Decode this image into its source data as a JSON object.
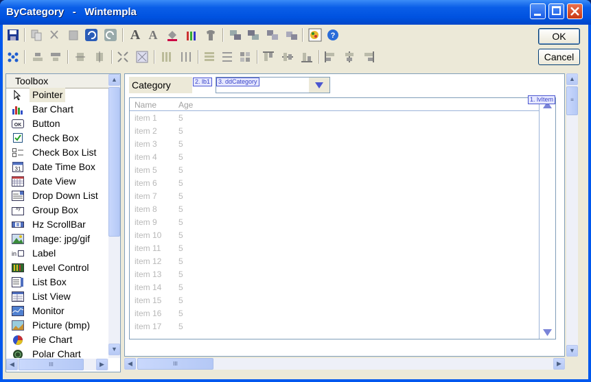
{
  "window": {
    "title": "ByCategory   -   Wintempla"
  },
  "buttons": {
    "ok": "OK",
    "cancel": "Cancel"
  },
  "toolbox": {
    "header": "Toolbox",
    "items": [
      {
        "label": "Pointer",
        "icon": "pointer-icon"
      },
      {
        "label": "Bar Chart",
        "icon": "bar-chart-icon"
      },
      {
        "label": "Button",
        "icon": "button-icon"
      },
      {
        "label": "Check Box",
        "icon": "check-box-icon"
      },
      {
        "label": "Check Box List",
        "icon": "check-box-list-icon"
      },
      {
        "label": "Date Time Box",
        "icon": "date-time-box-icon"
      },
      {
        "label": "Date View",
        "icon": "date-view-icon"
      },
      {
        "label": "Drop Down List",
        "icon": "drop-down-list-icon"
      },
      {
        "label": "Group Box",
        "icon": "group-box-icon"
      },
      {
        "label": "Hz ScrollBar",
        "icon": "hz-scrollbar-icon"
      },
      {
        "label": "Image: jpg/gif",
        "icon": "image-icon"
      },
      {
        "label": "Label",
        "icon": "label-icon"
      },
      {
        "label": "Level Control",
        "icon": "level-control-icon"
      },
      {
        "label": "List Box",
        "icon": "list-box-icon"
      },
      {
        "label": "List View",
        "icon": "list-view-icon"
      },
      {
        "label": "Monitor",
        "icon": "monitor-icon"
      },
      {
        "label": "Picture (bmp)",
        "icon": "picture-icon"
      },
      {
        "label": "Pie Chart",
        "icon": "pie-chart-icon"
      },
      {
        "label": "Polar Chart",
        "icon": "polar-chart-icon"
      }
    ],
    "icon_glyphs": {
      "button": "OK",
      "date": "31",
      "group": "xy",
      "label": "in"
    }
  },
  "design": {
    "category_label": "Category",
    "tag_lb1": "2. lb1",
    "tag_dd": "3. ddCategory",
    "tag_lv": "1. lvItem",
    "listview": {
      "columns": [
        "Name",
        "Age"
      ],
      "rows": [
        [
          "item 1",
          "5"
        ],
        [
          "item 2",
          "5"
        ],
        [
          "item 3",
          "5"
        ],
        [
          "item 4",
          "5"
        ],
        [
          "item 5",
          "5"
        ],
        [
          "item 6",
          "5"
        ],
        [
          "item 7",
          "5"
        ],
        [
          "item 8",
          "5"
        ],
        [
          "item 9",
          "5"
        ],
        [
          "item 10",
          "5"
        ],
        [
          "item 11",
          "5"
        ],
        [
          "item 12",
          "5"
        ],
        [
          "item 13",
          "5"
        ],
        [
          "item 14",
          "5"
        ],
        [
          "item 15",
          "5"
        ],
        [
          "item 16",
          "5"
        ],
        [
          "item 17",
          "5"
        ]
      ]
    }
  },
  "scroll": {
    "thumb_glyph": "III"
  },
  "colors": {
    "titlebar": "#0058ee",
    "face": "#ece9d8",
    "accent": "#3a44c8"
  }
}
